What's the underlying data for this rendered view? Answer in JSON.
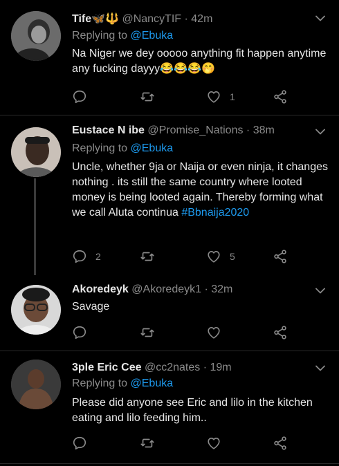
{
  "tweets": [
    {
      "name": "Tife🦋🔱",
      "handle": "@NancyTIF",
      "time": "· 42m",
      "replying_label": "Replying to",
      "replying_to": "@Ebuka",
      "text": "Na Niger we dey ooooo anything fit happen anytime any fucking dayyy😂😂😂🤭",
      "hashtag": "",
      "reply_count": "",
      "retweet_count": "",
      "like_count": "1"
    },
    {
      "name": "Eustace N ibe",
      "handle": "@Promise_Nations",
      "time": "· 38m",
      "replying_label": "Replying to",
      "replying_to": "@Ebuka",
      "text": "Uncle, whether 9ja or Naija or even ninja, it changes nothing . its still the same country where looted money is being looted again. Thereby forming what we call Aluta continua",
      "hashtag": "#Bbnaija2020",
      "reply_count": "2",
      "retweet_count": "",
      "like_count": "5"
    },
    {
      "name": "Akoredeyk",
      "handle": "@Akoredeyk1",
      "time": "· 32m",
      "replying_label": "",
      "replying_to": "",
      "text": "Savage",
      "hashtag": "",
      "reply_count": "",
      "retweet_count": "",
      "like_count": ""
    },
    {
      "name": "3ple Eric Cee",
      "handle": "@cc2nates",
      "time": "· 19m",
      "replying_label": "Replying to",
      "replying_to": "@Ebuka",
      "text": "Please did anyone see Eric and lilo in the kitchen eating and lilo feeding him..",
      "hashtag": "",
      "reply_count": "",
      "retweet_count": "",
      "like_count": ""
    }
  ],
  "colors": {
    "background": "#000000",
    "link": "#1d9bf0",
    "muted": "#8a8a8a",
    "text": "#e6e6e6"
  },
  "icons": [
    "chevron-down-icon",
    "reply-icon",
    "retweet-icon",
    "like-icon",
    "share-icon"
  ]
}
